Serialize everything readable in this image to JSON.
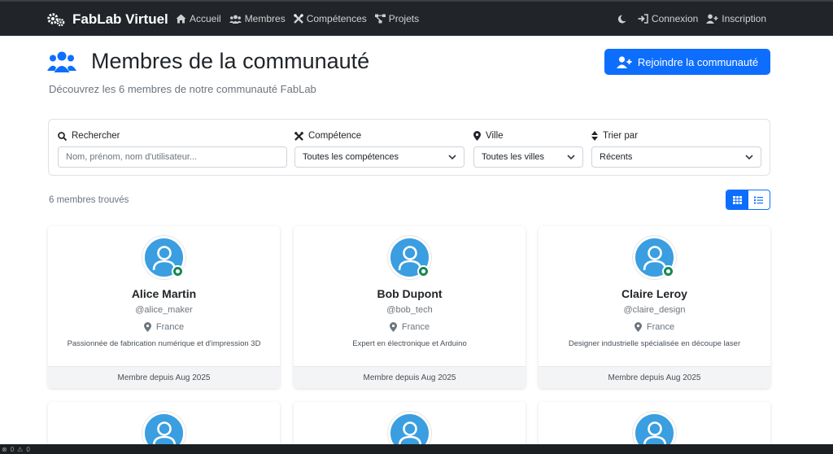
{
  "nav": {
    "brand": "FabLab Virtuel",
    "links": [
      {
        "label": "Accueil",
        "icon": "home-icon"
      },
      {
        "label": "Membres",
        "icon": "users-icon"
      },
      {
        "label": "Compétences",
        "icon": "tools-icon"
      },
      {
        "label": "Projets",
        "icon": "project-diagram-icon"
      }
    ],
    "login": "Connexion",
    "register": "Inscription"
  },
  "header": {
    "title": "Membres de la communauté",
    "subtitle": "Découvrez les 6 membres de notre communauté FabLab",
    "join_button": "Rejoindre la communauté"
  },
  "filters": {
    "search": {
      "label": "Rechercher",
      "placeholder": "Nom, prénom, nom d'utilisateur..."
    },
    "skill": {
      "label": "Compétence",
      "value": "Toutes les compétences"
    },
    "city": {
      "label": "Ville",
      "value": "Toutes les villes"
    },
    "sort": {
      "label": "Trier par",
      "value": "Récents"
    }
  },
  "results": {
    "count_text": "6 membres trouvés"
  },
  "members": [
    {
      "name": "Alice Martin",
      "username": "@alice_maker",
      "location": "France",
      "bio": "Passionnée de fabrication numérique et d'impression 3D",
      "since": "Membre depuis Aug 2025"
    },
    {
      "name": "Bob Dupont",
      "username": "@bob_tech",
      "location": "France",
      "bio": "Expert en électronique et Arduino",
      "since": "Membre depuis Aug 2025"
    },
    {
      "name": "Claire Leroy",
      "username": "@claire_design",
      "location": "France",
      "bio": "Designer industrielle spécialisée en découpe laser",
      "since": "Membre depuis Aug 2025"
    }
  ],
  "statusbar": {
    "errors": "0",
    "warnings": "0"
  },
  "colors": {
    "primary": "#0d6efd",
    "navbar": "#212529",
    "avatar": "#3a9ee0",
    "online": "#198754"
  }
}
